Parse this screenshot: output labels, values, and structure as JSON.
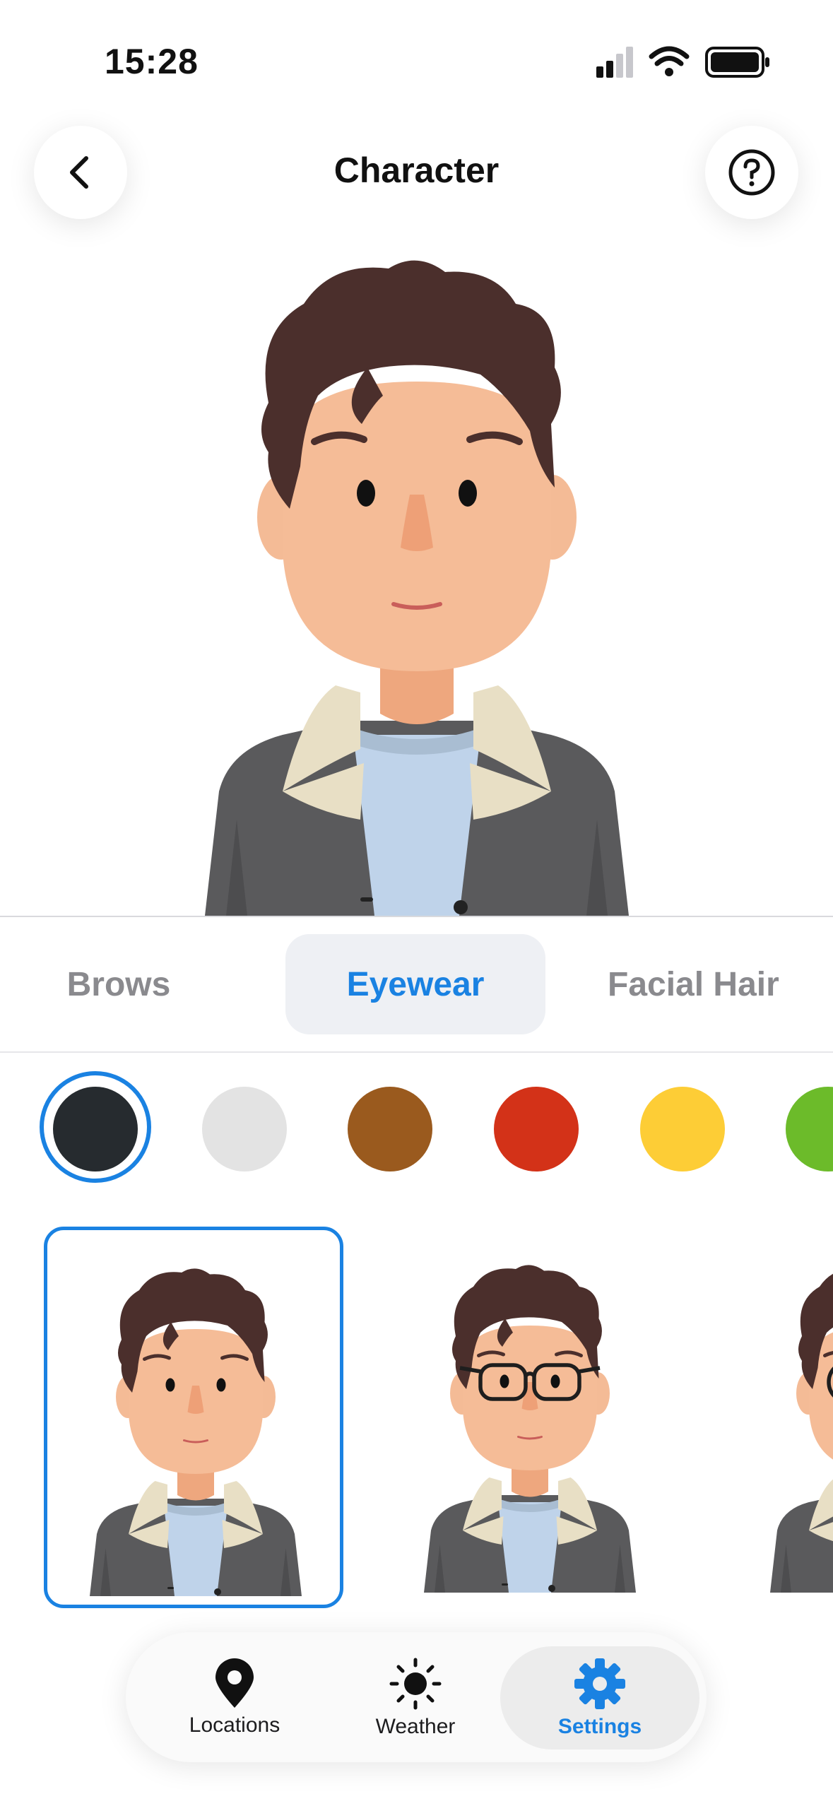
{
  "status": {
    "time": "15:28"
  },
  "header": {
    "title": "Character",
    "back_icon": "chevron-left-icon",
    "help_icon": "question-circle-icon"
  },
  "category_tabs": [
    {
      "label": "Brows",
      "selected": false
    },
    {
      "label": "Eyewear",
      "selected": true
    },
    {
      "label": "Facial Hair",
      "selected": false
    }
  ],
  "colors": {
    "accent": "#1a82e2",
    "swatches": [
      "#262b2f",
      "#e3e3e3",
      "#9a5a1e",
      "#d33218",
      "#fdcd36",
      "#6cbb2a"
    ],
    "selected_swatch": 0
  },
  "options": [
    {
      "name": "no-glasses",
      "selected": true
    },
    {
      "name": "round-glasses",
      "selected": false
    },
    {
      "name": "third-option-partial",
      "selected": false
    }
  ],
  "nav": [
    {
      "label": "Locations",
      "icon": "location-pin-icon",
      "active": false
    },
    {
      "label": "Weather",
      "icon": "sun-icon",
      "active": false
    },
    {
      "label": "Settings",
      "icon": "gear-icon",
      "active": true
    }
  ]
}
